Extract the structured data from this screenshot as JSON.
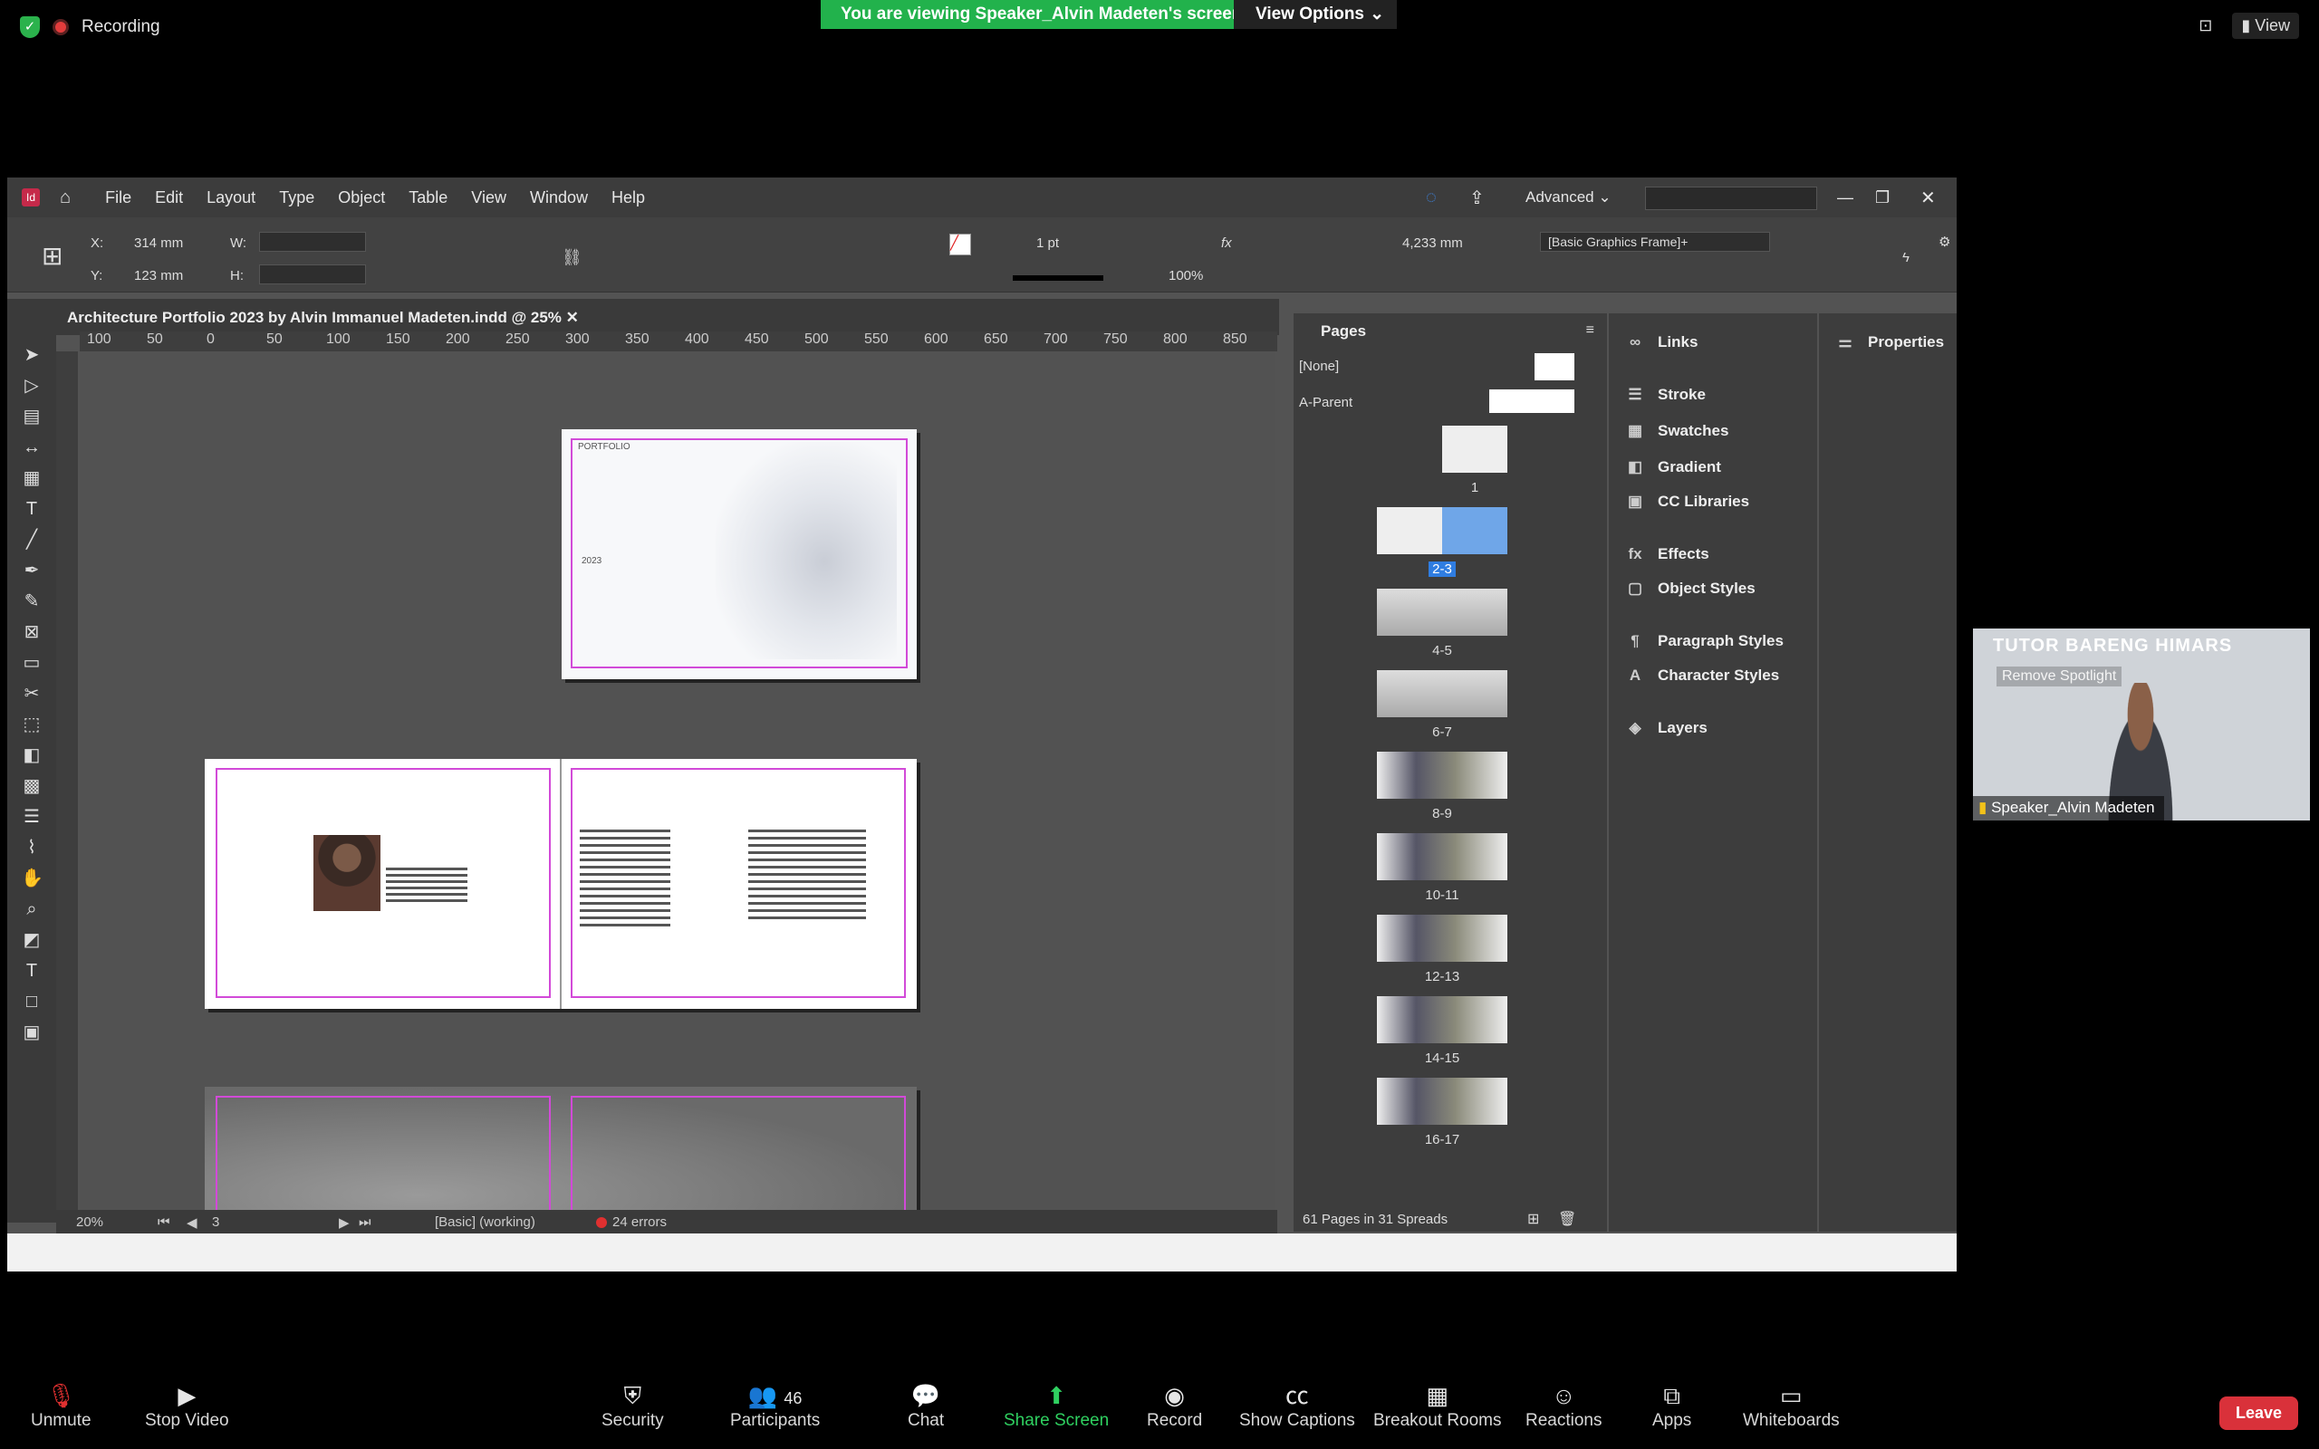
{
  "zoom": {
    "recording_label": "Recording",
    "viewing_banner": "You are viewing Speaker_Alvin Madeten's screen",
    "view_options": "View Options",
    "view_button": "View",
    "bottom": {
      "unmute": "Unmute",
      "stop_video": "Stop Video",
      "security": "Security",
      "participants": "Participants",
      "participants_count": "46",
      "chat": "Chat",
      "share_screen": "Share Screen",
      "record": "Record",
      "captions": "Show Captions",
      "breakout": "Breakout Rooms",
      "reactions": "Reactions",
      "apps": "Apps",
      "whiteboards": "Whiteboards",
      "leave": "Leave"
    },
    "spotlight": {
      "banner": "TUTOR BARENG HIMARS",
      "remove": "Remove Spotlight",
      "name": "Speaker_Alvin Madeten"
    }
  },
  "indesign": {
    "menus": [
      "File",
      "Edit",
      "Layout",
      "Type",
      "Object",
      "Table",
      "View",
      "Window",
      "Help"
    ],
    "workspace": "Advanced",
    "control": {
      "x_label": "X:",
      "x_value": "314 mm",
      "y_label": "Y:",
      "y_value": "123 mm",
      "w_label": "W:",
      "h_label": "H:",
      "stroke_weight": "1 pt",
      "opacity": "100%",
      "gap_value": "4,233 mm",
      "object_style": "[Basic Graphics Frame]+"
    },
    "doc_tab": "Architecture Portfolio 2023 by Alvin Immanuel Madeten.indd @ 25%",
    "ruler_ticks": [
      "100",
      "50",
      "0",
      "50",
      "100",
      "150",
      "200",
      "250",
      "300",
      "350",
      "400",
      "450",
      "500",
      "550",
      "600",
      "650",
      "700",
      "750",
      "800",
      "850"
    ],
    "cover": {
      "title": "PORTFOLIO",
      "year": "2023"
    },
    "status": {
      "zoom": "20%",
      "page": "3",
      "preflight_profile": "[Basic] (working)",
      "errors": "24 errors"
    },
    "pages_panel": {
      "title": "Pages",
      "none_label": "[None]",
      "parent_label": "A-Parent",
      "spreads": [
        "1",
        "2-3",
        "4-5",
        "6-7",
        "8-9",
        "10-11",
        "12-13",
        "14-15",
        "16-17"
      ],
      "footer": "61 Pages in 31 Spreads"
    },
    "panels": [
      "Links",
      "Stroke",
      "Swatches",
      "Gradient",
      "CC Libraries",
      "Effects",
      "Object Styles",
      "Paragraph Styles",
      "Character Styles",
      "Layers"
    ],
    "properties": "Properties"
  }
}
